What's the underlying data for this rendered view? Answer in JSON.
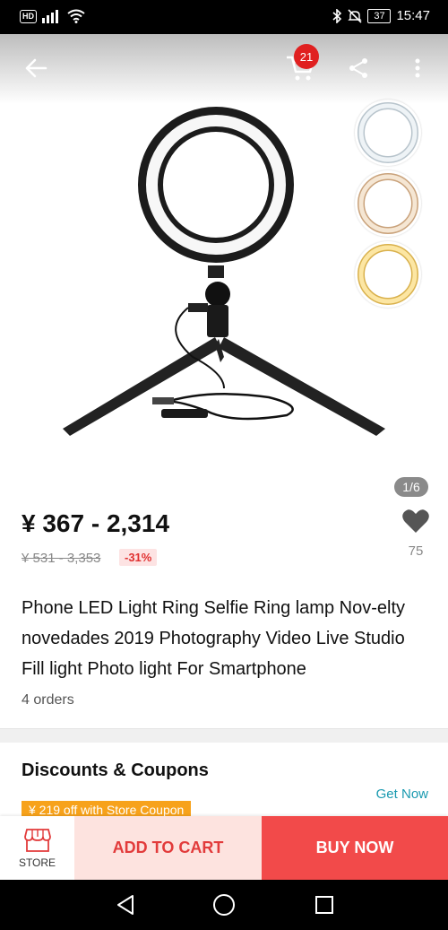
{
  "status_bar": {
    "network": "HD",
    "battery": "37",
    "time": "15:47"
  },
  "header": {
    "cart_count": "21"
  },
  "gallery": {
    "pager": "1/6"
  },
  "product": {
    "price": "¥ 367 - 2,314",
    "original_price": "¥ 531 - 3,353",
    "discount": "-31%",
    "wishlist_count": "75",
    "title": "Phone LED Light Ring Selfie Ring lamp Nov-elty novedades 2019 Photography Video Live Studio Fill light Photo light For Smartphone",
    "orders": "4 orders"
  },
  "discounts": {
    "title": "Discounts & Coupons",
    "get_now": "Get Now",
    "coupon": "¥ 219 off with Store Coupon"
  },
  "bottom_bar": {
    "store_label": "STORE",
    "add_to_cart": "ADD TO CART",
    "buy_now": "BUY NOW"
  },
  "colors": {
    "accent_red": "#f24a4a",
    "badge_red": "#e02020",
    "link_teal": "#1a9ab0",
    "coupon_orange": "#f7a21b"
  }
}
